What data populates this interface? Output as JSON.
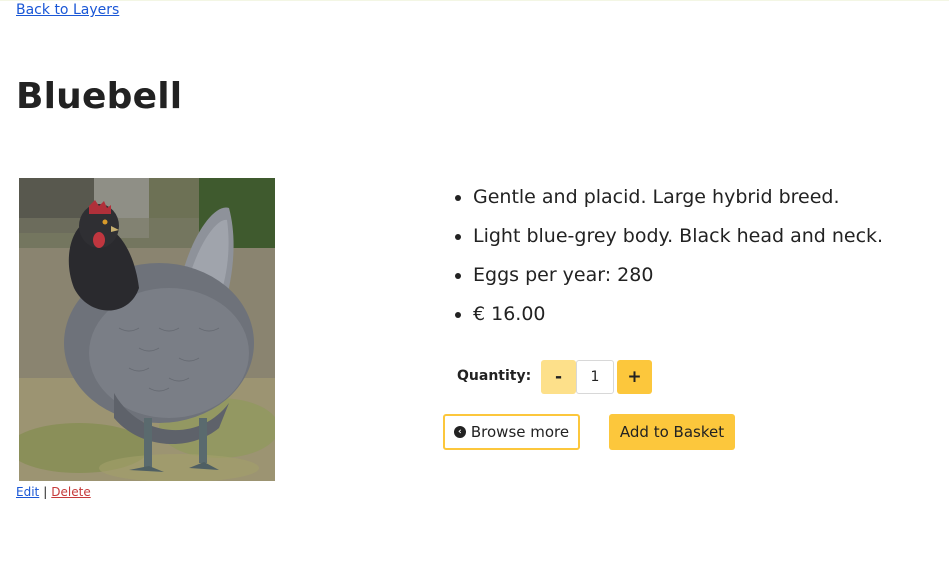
{
  "nav": {
    "back_label": "Back to Layers"
  },
  "product": {
    "name": "Bluebell",
    "image_subject": "grey hen photo",
    "details": [
      "Gentle and placid. Large hybrid breed.",
      "Light blue-grey body. Black head and neck.",
      "Eggs per year: 280",
      "€ 16.00"
    ]
  },
  "admin": {
    "edit_label": "Edit",
    "separator": "|",
    "delete_label": "Delete"
  },
  "quantity": {
    "label": "Quantity:",
    "minus_label": "-",
    "value": "1",
    "plus_label": "+"
  },
  "actions": {
    "browse_label": "Browse more",
    "browse_icon": "chevron-left-circle-icon",
    "basket_label": "Add to Basket"
  },
  "colors": {
    "link": "#1a57d6",
    "delete": "#c63a3a",
    "accent": "#fcc73c",
    "accent_light": "#fde08a"
  }
}
